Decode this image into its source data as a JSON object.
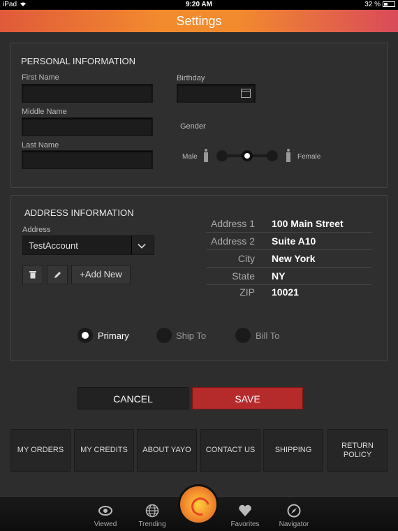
{
  "status": {
    "device": "iPad",
    "time": "9:20 AM",
    "battery": "32 %"
  },
  "header": {
    "title": "Settings"
  },
  "personal": {
    "title": "PERSONAL INFORMATION",
    "first_name_label": "First Name",
    "middle_name_label": "Middle Name",
    "last_name_label": "Last Name",
    "birthday_label": "Birthday",
    "gender_label": "Gender",
    "male_label": "Male",
    "female_label": "Female",
    "gender_value": "unspecified"
  },
  "address": {
    "title": "ADDRESS INFORMATION",
    "address_label": "Address",
    "selected": "TestAccount",
    "add_new": "+Add New",
    "rows": [
      {
        "key": "Address 1",
        "value": "100 Main Street"
      },
      {
        "key": "Address 2",
        "value": "Suite A10"
      },
      {
        "key": "City",
        "value": "New York"
      },
      {
        "key": "State",
        "value": "NY"
      },
      {
        "key": "ZIP",
        "value": "10021"
      }
    ],
    "radios": [
      {
        "label": "Primary",
        "selected": true
      },
      {
        "label": "Ship To",
        "selected": false
      },
      {
        "label": "Bill To",
        "selected": false
      }
    ]
  },
  "actions": {
    "cancel": "CANCEL",
    "save": "SAVE"
  },
  "nav_buttons": [
    "MY ORDERS",
    "MY CREDITS",
    "ABOUT YAYO",
    "CONTACT US",
    "SHIPPING",
    "RETURN POLICY"
  ],
  "tabs": [
    {
      "label": "Viewed",
      "icon": "eye-icon"
    },
    {
      "label": "Trending",
      "icon": "globe-icon"
    },
    {
      "label": "Favorites",
      "icon": "heart-icon"
    },
    {
      "label": "Navigator",
      "icon": "compass-icon"
    }
  ],
  "colors": {
    "accent": "#f28a2e",
    "save": "#b52a2a"
  }
}
